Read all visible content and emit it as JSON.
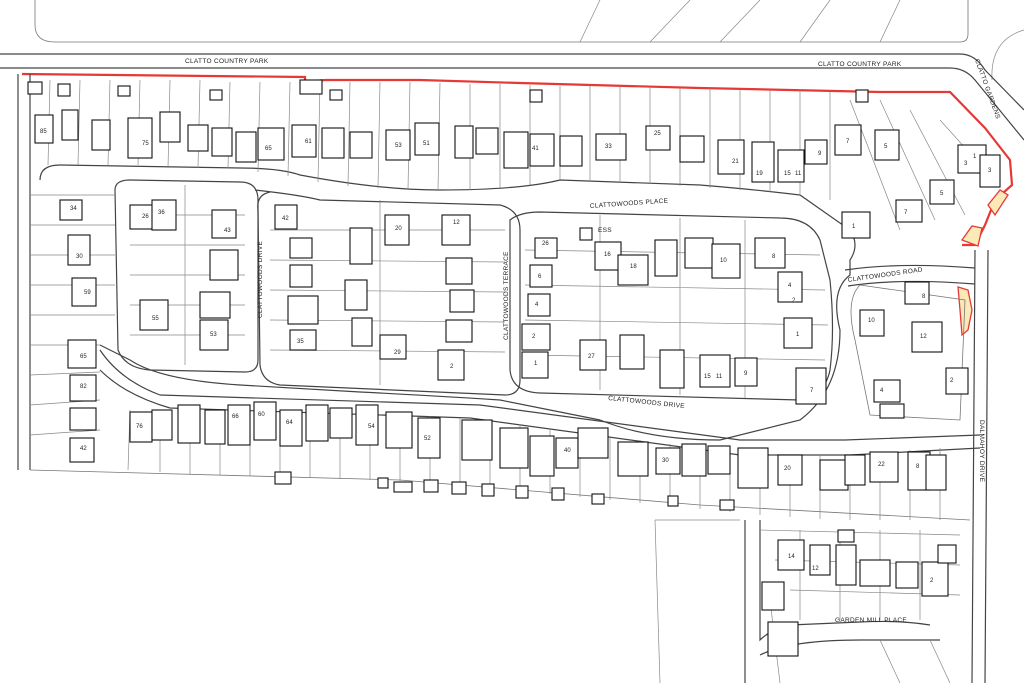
{
  "map": {
    "colors": {
      "site_boundary": "#e53935",
      "highlight_fill": "#fbe9b7",
      "building_stroke": "#111111",
      "road_stroke": "#444444",
      "plot_stroke": "#888888"
    },
    "road_labels": [
      {
        "id": "clatto-country-park-west",
        "text": "CLATTO COUNTRY PARK"
      },
      {
        "id": "clatto-country-park-east",
        "text": "CLATTO COUNTRY PARK"
      },
      {
        "id": "clatto-gardens",
        "text": "CLATTO GARDENS"
      },
      {
        "id": "clattowoods-place",
        "text": "CLATTOWOODS PLACE"
      },
      {
        "id": "clattowoods-road",
        "text": "CLATTOWOODS ROAD"
      },
      {
        "id": "clattowoods-drive-west",
        "text": "CLATTOWOODS DRIVE"
      },
      {
        "id": "clattowoods-terrace",
        "text": "CLATTOWOODS TERRACE"
      },
      {
        "id": "clattowoods-drive-south",
        "text": "CLATTOWOODS DRIVE"
      },
      {
        "id": "dalmahoy-drive",
        "text": "DALMAHOY DRIVE"
      },
      {
        "id": "garden-mill-place",
        "text": "GARDEN MILL PLACE"
      },
      {
        "id": "ess",
        "text": "ESS"
      }
    ],
    "house_numbers": [
      "85",
      "75",
      "65",
      "61",
      "53",
      "51",
      "41",
      "33",
      "25",
      "21",
      "19",
      "15",
      "11",
      "9",
      "7",
      "5",
      "3",
      "1",
      "3",
      "7",
      "5",
      "1",
      "34",
      "26",
      "36",
      "43",
      "30",
      "59",
      "55",
      "53",
      "65",
      "82",
      "42",
      "42",
      "20",
      "12",
      "26",
      "35",
      "29",
      "2",
      "6",
      "4",
      "2",
      "1",
      "16",
      "18",
      "27",
      "15",
      "11",
      "9",
      "10",
      "8",
      "4",
      "2",
      "1",
      "7",
      "8",
      "10",
      "12",
      "4",
      "2",
      "76",
      "66",
      "60",
      "64",
      "54",
      "52",
      "40",
      "30",
      "20",
      "22",
      "8",
      "14",
      "12",
      "2"
    ]
  }
}
